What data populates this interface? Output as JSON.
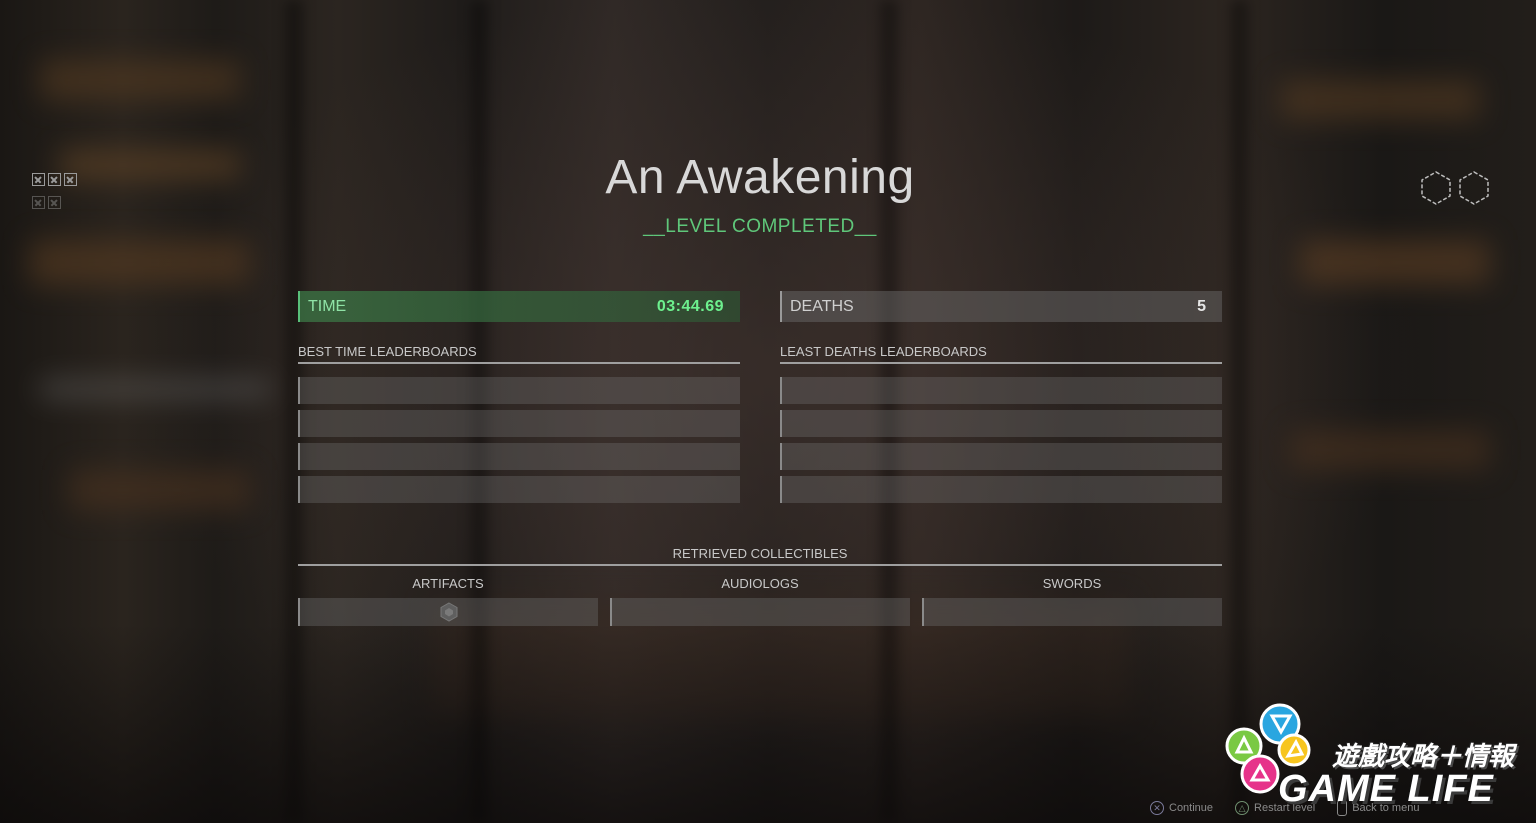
{
  "level": {
    "title": "An Awakening",
    "status": "__LEVEL COMPLETED__"
  },
  "stats": {
    "time_label": "TIME",
    "time_value": "03:44.69",
    "deaths_label": "DEATHS",
    "deaths_value": "5"
  },
  "leaderboards": {
    "best_time_title": "BEST TIME LEADERBOARDS",
    "least_deaths_title": "LEAST DEATHS LEADERBOARDS",
    "rows_per_board": 4
  },
  "collectibles": {
    "title": "RETRIEVED COLLECTIBLES",
    "categories": [
      {
        "label": "ARTIFACTS",
        "collected_icons": [
          "hexagon-artifact-icon"
        ]
      },
      {
        "label": "AUDIOLOGS",
        "collected_icons": []
      },
      {
        "label": "SWORDS",
        "collected_icons": []
      }
    ]
  },
  "hud": {
    "top_left_icons": [
      "checkbox-x-icon",
      "checkbox-x-icon",
      "checkbox-x-icon",
      "checkbox-x-icon",
      "checkbox-x-icon"
    ],
    "top_right_icons": [
      "hexagon-icon",
      "hexagon-icon"
    ]
  },
  "controls": [
    {
      "glyph": "✕",
      "icon": "cross-button-icon",
      "label": "Continue"
    },
    {
      "glyph": "△",
      "icon": "triangle-button-icon",
      "label": "Restart level"
    },
    {
      "glyph": "",
      "icon": "touchpad-button-icon",
      "label": "Back to menu"
    }
  ],
  "watermark": {
    "cjk_text": "遊戲攻略＋情報",
    "text": "GAME LIFE"
  },
  "colors": {
    "accent_green": "#5fc77a",
    "time_value_green": "#6df08e"
  }
}
